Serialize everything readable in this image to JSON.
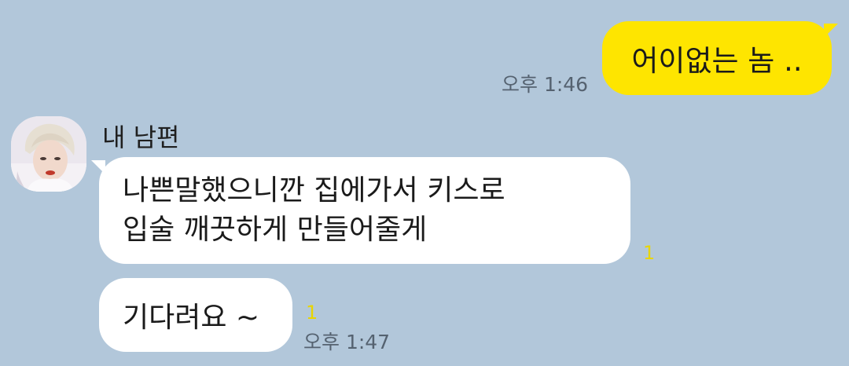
{
  "outgoing": {
    "text": "어이없는 놈 ..",
    "time": "오후 1:46"
  },
  "incoming": {
    "sender_name": "내 남편",
    "messages": [
      {
        "lines": [
          "나쁜말했으니깐 집에가서 키스로",
          "입술 깨끗하게 만들어줄게"
        ],
        "unread": "1"
      },
      {
        "text": "기다려요 ~",
        "unread": "1",
        "time": "오후 1:47"
      }
    ]
  },
  "colors": {
    "background": "#b2c7da",
    "outgoing_bubble": "#fee500",
    "incoming_bubble": "#ffffff",
    "unread_count": "#e8d500",
    "time_text": "#556270"
  },
  "icons": {
    "avatar": "profile-photo"
  }
}
